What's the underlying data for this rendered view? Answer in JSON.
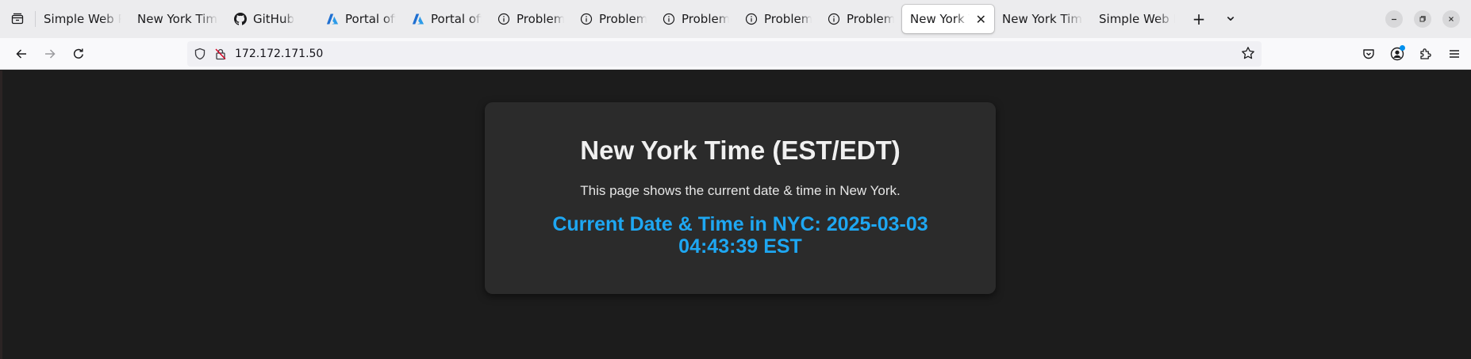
{
  "browser": {
    "tabs": [
      {
        "label": "Simple Web Pa",
        "icon": "none"
      },
      {
        "label": "New York Time",
        "icon": "none"
      },
      {
        "label": "GitHub",
        "icon": "github-icon"
      },
      {
        "label": "Portal offlin",
        "icon": "azure-icon"
      },
      {
        "label": "Portal offlin",
        "icon": "azure-icon"
      },
      {
        "label": "Problem loa",
        "icon": "info-icon"
      },
      {
        "label": "Problem loa",
        "icon": "info-icon"
      },
      {
        "label": "Problem loa",
        "icon": "info-icon"
      },
      {
        "label": "Problem loa",
        "icon": "info-icon"
      },
      {
        "label": "Problem loa",
        "icon": "info-icon"
      },
      {
        "label": "New York Tim",
        "icon": "none",
        "active": true
      },
      {
        "label": "New York Time",
        "icon": "none"
      },
      {
        "label": "Simple Web Pa",
        "icon": "none"
      }
    ],
    "new_tab_glyph": "+",
    "tab_list_glyph": "⌄",
    "close_tab_glyph": "✕",
    "address": "172.172.171.50",
    "accent_color": "#0090ed"
  },
  "page": {
    "title": "New York Time (EST/EDT)",
    "description": "This page shows the current date & time in New York.",
    "time_line": "Current Date & Time in NYC: 2025-03-03 04:43:39 EST",
    "time_color": "#1ea7f2",
    "background_color": "#1c1c1c",
    "card_color": "#2b2b2b"
  }
}
